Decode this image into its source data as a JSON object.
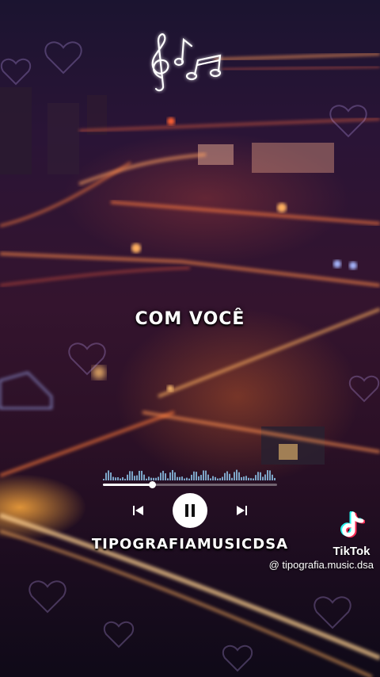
{
  "overlay": {
    "lyric": "COM VOCÊ",
    "brand": "TIPOGRAFIAMUSICDSA"
  },
  "player": {
    "progress": 0.28,
    "state": "playing",
    "prev_icon": "skip-previous-icon",
    "pause_icon": "pause-icon",
    "next_icon": "skip-next-icon"
  },
  "watermark": {
    "logo_icon": "tiktok-logo-icon",
    "word": "TikTok",
    "handle": "@ tipografia.music.dsa"
  },
  "colors": {
    "neon": "#ffffff",
    "city_glow": "#ff7a2a",
    "sky": "#1b1430"
  }
}
